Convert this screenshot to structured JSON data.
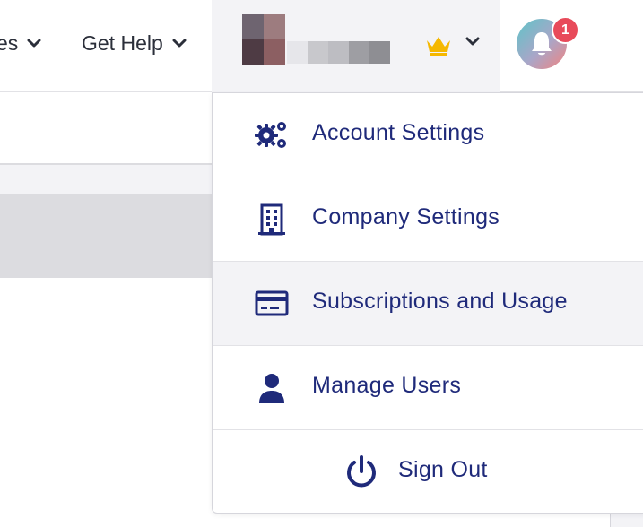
{
  "nav": {
    "prev_label": "es",
    "get_help_label": "Get Help",
    "chevron_icon": "chevron-down-icon"
  },
  "user_menu": {
    "crown_icon": "crown-icon",
    "crown_color": "#f5b800"
  },
  "notifications": {
    "badge_count": "1",
    "badge_color": "#e84a5a",
    "icon": "bell-icon"
  },
  "dropdown": {
    "items": [
      {
        "label": "Account Settings",
        "icon": "gears-icon"
      },
      {
        "label": "Company Settings",
        "icon": "building-icon"
      },
      {
        "label": "Subscriptions and Usage",
        "icon": "credit-card-icon"
      },
      {
        "label": "Manage Users",
        "icon": "user-icon"
      },
      {
        "label": "Sign Out",
        "icon": "power-icon"
      }
    ]
  },
  "colors": {
    "accent": "#1f2a7a",
    "menu_hover_bg": "#f3f3f6",
    "divider": "#e2e2e6"
  }
}
